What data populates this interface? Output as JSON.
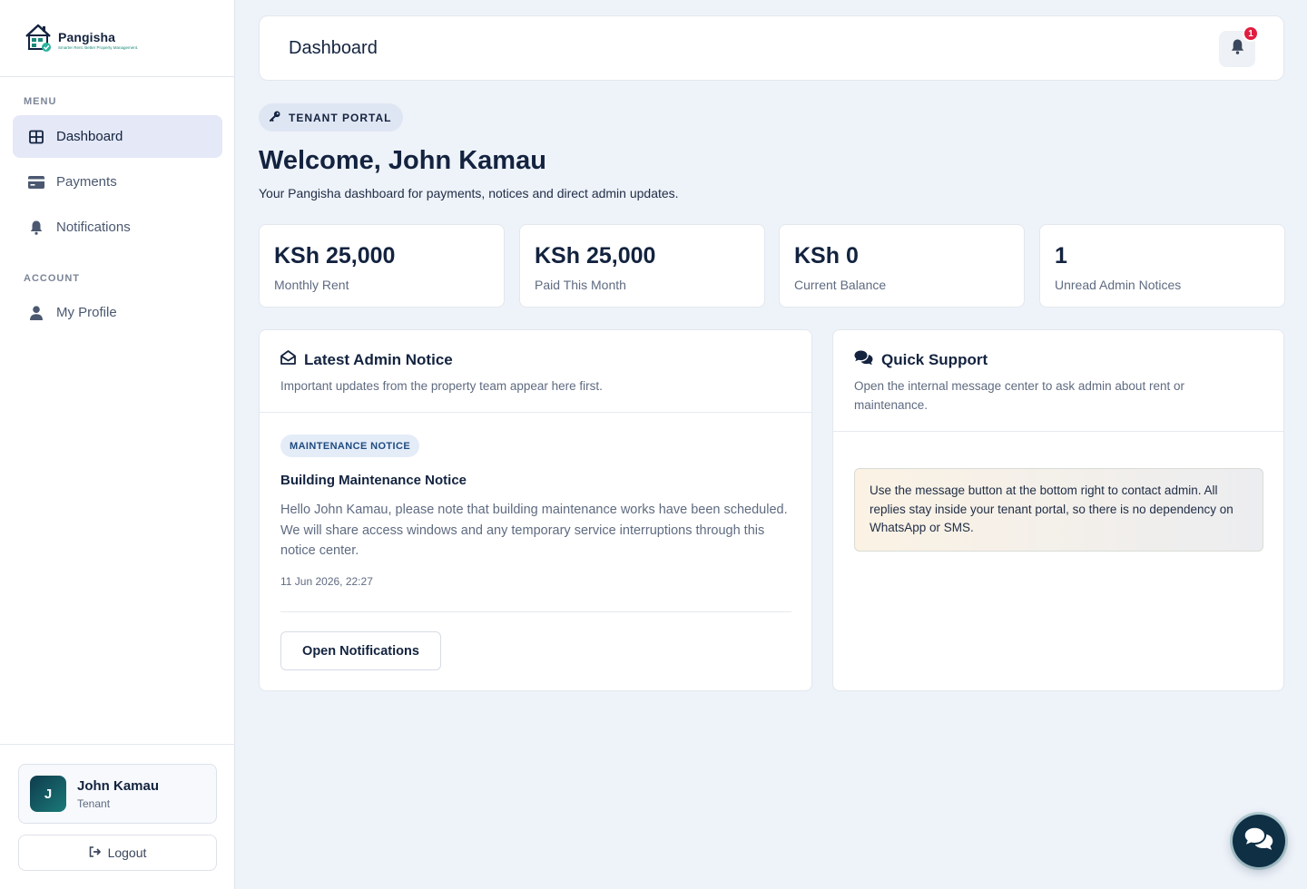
{
  "brand": {
    "name": "Pangisha",
    "tagline": "Smarter Rent. Better Property Management."
  },
  "sidebar": {
    "menu_label": "MENU",
    "account_label": "ACCOUNT",
    "items": [
      {
        "label": "Dashboard",
        "icon": "dashboard-grid-icon",
        "active": true
      },
      {
        "label": "Payments",
        "icon": "credit-card-icon",
        "active": false
      },
      {
        "label": "Notifications",
        "icon": "bell-icon",
        "active": false
      },
      {
        "label": "My Profile",
        "icon": "user-icon",
        "active": false
      }
    ],
    "user": {
      "initial": "J",
      "name": "John Kamau",
      "role": "Tenant"
    },
    "logout_label": "Logout"
  },
  "topbar": {
    "title": "Dashboard",
    "notification_count": "1"
  },
  "welcome": {
    "pill": "TENANT PORTAL",
    "title": "Welcome, John Kamau",
    "subtitle": "Your Pangisha dashboard for payments, notices and direct admin updates."
  },
  "stats": [
    {
      "value": "KSh 25,000",
      "label": "Monthly Rent"
    },
    {
      "value": "KSh 25,000",
      "label": "Paid This Month"
    },
    {
      "value": "KSh 0",
      "label": "Current Balance"
    },
    {
      "value": "1",
      "label": "Unread Admin Notices"
    }
  ],
  "latest_notice": {
    "title": "Latest Admin Notice",
    "subtitle": "Important updates from the property team appear here first.",
    "tag": "MAINTENANCE NOTICE",
    "notice_title": "Building Maintenance Notice",
    "body": "Hello John Kamau, please note that building maintenance works have been scheduled. We will share access windows and any temporary service interruptions through this notice center.",
    "date": "11 Jun 2026, 22:27",
    "button_label": "Open Notifications"
  },
  "quick_support": {
    "title": "Quick Support",
    "subtitle": "Open the internal message center to ask admin about rent or maintenance.",
    "message": "Use the message button at the bottom right to contact admin. All replies stay inside your tenant portal, so there is no dependency on WhatsApp or SMS."
  },
  "colors": {
    "accent": "#13233f",
    "active_nav": "#e4e8f7",
    "badge": "#e11d3f",
    "fab": "#0f2f45"
  }
}
